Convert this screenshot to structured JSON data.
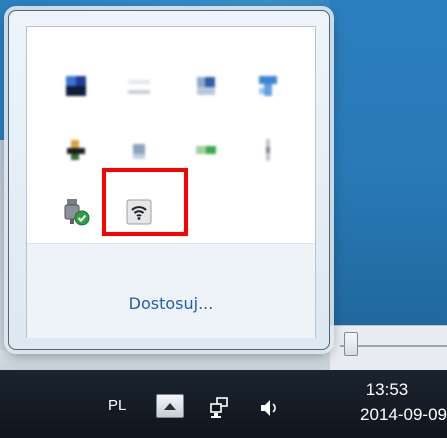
{
  "popup": {
    "icons": [
      {
        "name": "tray-app-icon-1",
        "state": "blurred"
      },
      {
        "name": "tray-app-icon-2",
        "state": "blurred"
      },
      {
        "name": "tray-app-icon-3",
        "state": "blurred"
      },
      {
        "name": "tray-app-icon-4",
        "state": "blurred"
      },
      {
        "name": "tray-app-icon-5",
        "state": "blurred"
      },
      {
        "name": "tray-app-icon-6",
        "state": "blurred"
      },
      {
        "name": "tray-app-icon-7",
        "state": "blurred"
      },
      {
        "name": "tray-app-icon-8",
        "state": "blurred"
      },
      {
        "name": "usb-safely-remove-icon",
        "state": "visible"
      },
      {
        "name": "wifi-adapter-icon",
        "state": "highlighted"
      }
    ],
    "customize_label": "Dostosuj...",
    "highlight_color": "#ff0000"
  },
  "taskbar": {
    "language": "PL",
    "time": "13:53",
    "date": "2014-09-09"
  }
}
